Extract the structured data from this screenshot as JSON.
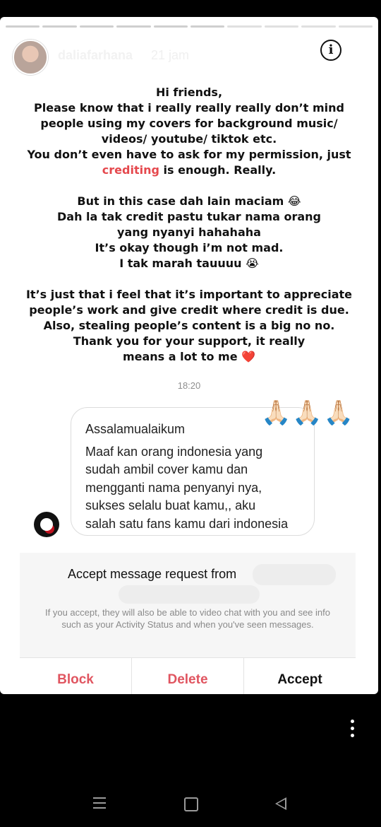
{
  "story": {
    "username": "daliafarhana",
    "time_ago": "21 jam",
    "progress_total": 10,
    "progress_done": 6
  },
  "note": {
    "p1_line1": "Hi friends,",
    "p1_line2": "Please know that i really really really don’t mind",
    "p1_line3": "people using my covers for background music/",
    "p1_line4": "videos/ youtube/ tiktok etc.",
    "p1_line5": "You don’t even have to ask for my permission, just",
    "p1_highlight": "crediting",
    "p1_line6_rest": " is enough. Really.",
    "p2_line1": "But in this case dah lain maciam 😂",
    "p2_line2": "Dah la tak credit pastu tukar nama orang",
    "p2_line3": "yang nyanyi hahahaha",
    "p2_line4": "It’s okay though i’m not mad.",
    "p2_line5": "I tak marah tauuuu 😭",
    "p3_line1": "It’s just that i feel that it’s important to appreciate",
    "p3_line2": "people’s work and give credit where credit is due.",
    "p3_line3": "Also, stealing people’s content is a big no no.",
    "p3_line4": "Thank you for your support, it really",
    "p3_line5": "means a lot to me ❤️"
  },
  "message": {
    "time": "18:20",
    "greeting": "Assalamualaikum",
    "line1": "Maaf kan orang indonesia yang",
    "line2": "sudah ambil cover kamu dan",
    "line3": "mengganti nama penyanyi nya,",
    "line4": "sukses selalu buat kamu,, aku",
    "line5": "salah satu fans kamu dari indonesia",
    "reaction": "🙏🏻🙏🏻🙏🏻"
  },
  "request": {
    "title": "Accept message request from",
    "description": "If you accept, they will also be able to video chat with you and see info such as your Activity Status and when you've seen messages."
  },
  "actions": {
    "block": "Block",
    "delete": "Delete",
    "accept": "Accept"
  },
  "colors": {
    "highlight": "#e5484d",
    "destructive": "#e05560"
  }
}
